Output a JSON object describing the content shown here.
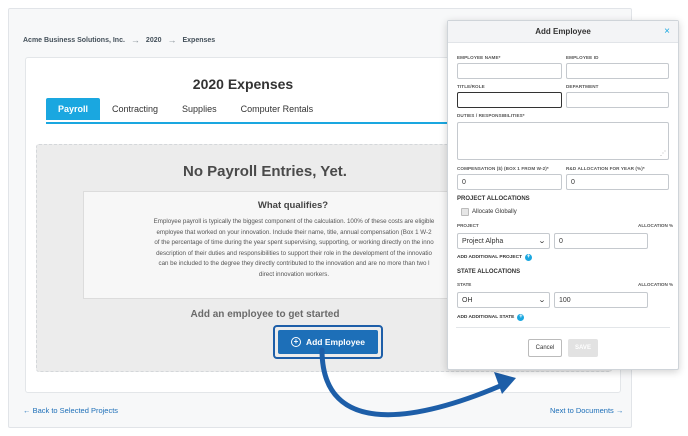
{
  "breadcrumb": {
    "company": "Acme Business Solutions, Inc.",
    "year": "2020",
    "section": "Expenses",
    "separator": "→"
  },
  "page": {
    "title": "2020 Expenses",
    "tabs": [
      {
        "label": "Payroll",
        "active": true
      },
      {
        "label": "Contracting",
        "active": false
      },
      {
        "label": "Supplies",
        "active": false
      },
      {
        "label": "Computer Rentals",
        "active": false
      }
    ]
  },
  "empty_state": {
    "title": "No Payroll Entries, Yet.",
    "qualifies_title": "What qualifies?",
    "qualifies_lines": [
      "Employee payroll is typically the biggest component of the calculation. 100% of these costs are eligible",
      "employee that worked on your innovation. Include their name, title, annual compensation (Box 1 W-2",
      "of the percentage of time during the year spent supervising, supporting, or working directly on the inno",
      "description of their duties and responsibilities to support their role in the development of the innovatio",
      "can be included to the degree they directly contributed to the innovation and are no more than two l",
      "direct innovation workers."
    ],
    "add_hint": "Add an employee to get started",
    "add_button": "Add Employee"
  },
  "footer": {
    "back": "← Back to Selected Projects",
    "next": "Next to Documents →"
  },
  "modal": {
    "title": "Add Employee",
    "close": "×",
    "labels": {
      "employee_name": "EMPLOYEE NAME*",
      "employee_id": "EMPLOYEE ID",
      "title_role": "TITLE/ROLE",
      "department": "DEPARTMENT",
      "duties": "DUTIES / RESPONSIBILITIES*",
      "compensation": "COMPENSATION ($) (BOX 1 FROM W-2)*",
      "rd_allocation": "R&D ALLOCATION FOR YEAR (%)*"
    },
    "values": {
      "employee_name": "",
      "employee_id": "",
      "title_role": "",
      "department": "",
      "duties": "",
      "compensation": "0",
      "rd_allocation": "0"
    },
    "project_allocations": {
      "heading": "PROJECT ALLOCATIONS",
      "allocate_globally": "Allocate Globally",
      "project_label": "PROJECT",
      "allocation_label": "ALLOCATION %",
      "project_value": "Project Alpha",
      "allocation_value": "0",
      "add_link": "ADD ADDITIONAL PROJECT"
    },
    "state_allocations": {
      "heading": "STATE ALLOCATIONS",
      "state_label": "STATE",
      "allocation_label": "ALLOCATION %",
      "state_value": "OH",
      "allocation_value": "100",
      "add_link": "ADD ADDITIONAL STATE"
    },
    "buttons": {
      "cancel": "Cancel",
      "save": "SAVE"
    }
  },
  "colors": {
    "accent": "#1aa7e0",
    "primary_button": "#1d6fb8",
    "annotation": "#1d5ea8"
  }
}
